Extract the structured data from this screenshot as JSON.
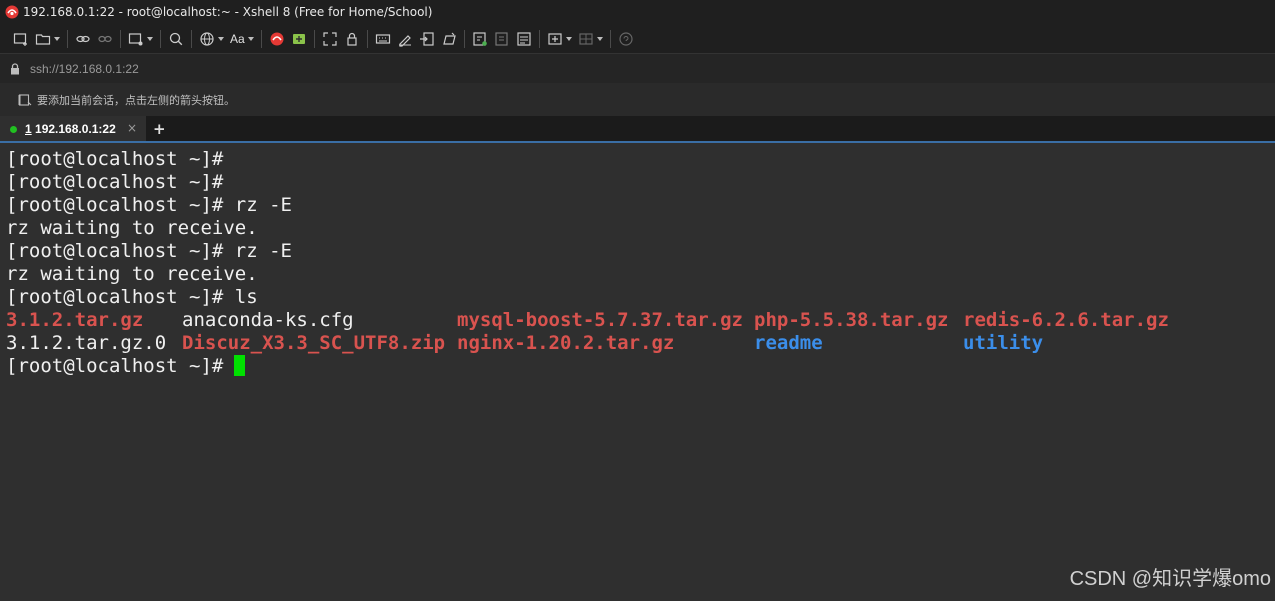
{
  "window": {
    "title": "192.168.0.1:22 - root@localhost:~ - Xshell 8 (Free for Home/School)",
    "accent_color": "#e53935"
  },
  "toolbar": {
    "font_label": "Aa",
    "icons": [
      "new-session-icon",
      "open-folder-icon",
      "link-icon",
      "unlink-icon",
      "new-window-icon",
      "search-icon",
      "globe-icon",
      "font-icon",
      "xshell-logo-icon",
      "xftp-icon",
      "fullscreen-icon",
      "lock-icon",
      "keyboard-icon",
      "script-icon",
      "transfer-icon",
      "compose-icon",
      "new-tab-icon",
      "tile-icon",
      "layout-icon",
      "add-window-icon",
      "split-icon",
      "help-icon"
    ]
  },
  "address": {
    "value": "ssh://192.168.0.1:22"
  },
  "hint": {
    "text": "要添加当前会话，点击左侧的箭头按钮。"
  },
  "tabs": [
    {
      "number": "1",
      "label": "192.168.0.1:22",
      "status_color": "#21c021",
      "close": "×"
    }
  ],
  "tab_add": "+",
  "terminal": {
    "prompt": "[root@localhost ~]#",
    "lines": [
      "[root@localhost ~]#",
      "[root@localhost ~]#",
      "[root@localhost ~]# rz -E",
      "rz waiting to receive.",
      "[root@localhost ~]# rz -E",
      "rz waiting to receive.",
      "[root@localhost ~]# ls"
    ],
    "ls_rows": [
      [
        {
          "text": "3.1.2.tar.gz",
          "color": "red"
        },
        {
          "text": "anaconda-ks.cfg",
          "color": "white"
        },
        {
          "text": "mysql-boost-5.7.37.tar.gz",
          "color": "red"
        },
        {
          "text": "php-5.5.38.tar.gz",
          "color": "red"
        },
        {
          "text": "redis-6.2.6.tar.gz",
          "color": "red"
        }
      ],
      [
        {
          "text": "3.1.2.tar.gz.0",
          "color": "white"
        },
        {
          "text": "Discuz_X3.3_SC_UTF8.zip",
          "color": "red"
        },
        {
          "text": "nginx-1.20.2.tar.gz",
          "color": "red"
        },
        {
          "text": "readme",
          "color": "blue"
        },
        {
          "text": "utility",
          "color": "blue"
        }
      ]
    ],
    "final_prompt": "[root@localhost ~]#",
    "cursor_color": "#00e000"
  },
  "watermark": "CSDN @知识学爆omo"
}
